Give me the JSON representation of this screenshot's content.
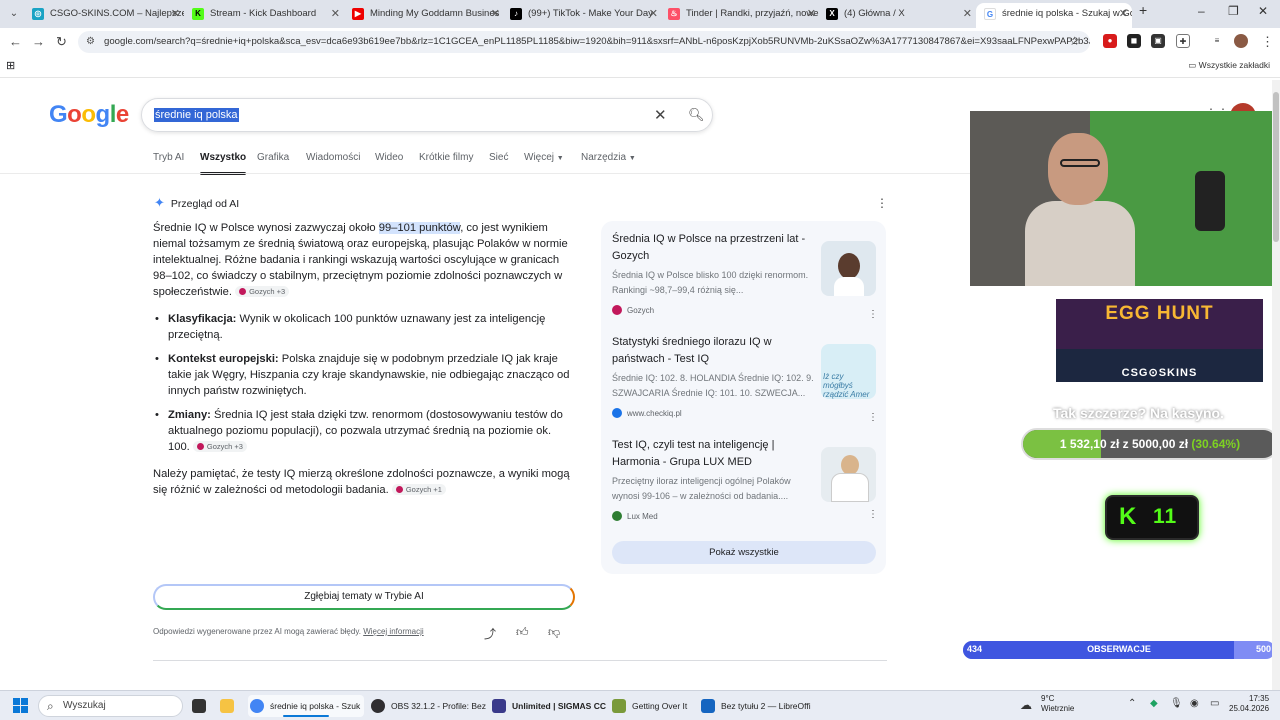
{
  "browser": {
    "tabs": [
      {
        "title": "CSGO-SKINS.COM – Najlepsze",
        "icon": "csgo-icon"
      },
      {
        "title": "Stream - Kick Dashboard",
        "icon": "kick-icon"
      },
      {
        "title": "Minding My Goddamn Busines",
        "icon": "youtube-icon"
      },
      {
        "title": "(99+) TikTok - Make Your Day",
        "icon": "tiktok-icon"
      },
      {
        "title": "Tinder | Randki, przyjaźń, nowe",
        "icon": "tinder-icon"
      },
      {
        "title": "(4) Główna / X",
        "icon": "x-icon"
      },
      {
        "title": "średnie iq polska - Szukaj w Go",
        "icon": "google-icon"
      }
    ],
    "url": "google.com/search?q=średnie+iq+polska&sca_esv=dca6e93b619ee7bb&rlz=1C1GCEA_enPL1185PL1185&biw=1920&bih=911&sxsrf=ANbL-n6posKzpjXob5RUNVMb-2uKSsaOZw%3A1777130847867&ei=X93saaLFNPexwPAP2b3Jw...",
    "bookmarks_label": "Wszystkie zakładki"
  },
  "google": {
    "logo": "Google",
    "query": "średnie iq polska",
    "tabs": [
      "Tryb AI",
      "Wszystko",
      "Grafika",
      "Wiadomości",
      "Wideo",
      "Krótkie filmy",
      "Sieć",
      "Więcej",
      "Narzędzia"
    ],
    "ai": {
      "heading": "Przegląd od AI",
      "intro_a": "Średnie IQ w Polsce wynosi zazwyczaj około ",
      "intro_hl": "99–101 punktów",
      "intro_b": ", co jest wynikiem niemal tożsamym ze średnią światową oraz europejską, plasując Polaków w normie intelektualnej. Różne badania i rankingi wskazują wartości oscylujące w granicach 98–102, co świadczy o stabilnym, przeciętnym poziomie zdolności poznawczych w społeczeństwie.",
      "intro_chip": "Gozych +3",
      "bullets": [
        {
          "label": "Klasyfikacja:",
          "text": " Wynik w okolicach 100 punktów uznawany jest za inteligencję przeciętną.",
          "chip": ""
        },
        {
          "label": "Kontekst europejski:",
          "text": " Polska znajduje się w podobnym przedziale IQ jak kraje takie jak Węgry, Hiszpania czy kraje skandynawskie, nie odbiegając znacząco od innych państw rozwiniętych.",
          "chip": ""
        },
        {
          "label": "Zmiany:",
          "text": " Średnia IQ jest stała dzięki tzw. renormom (dostosowywaniu testów do aktualnego poziomu populacji), co pozwala utrzymać średnią na poziomie ok. 100.",
          "chip": "Gozych +3"
        }
      ],
      "closing": "Należy pamiętać, że testy IQ mierzą określone zdolności poznawcze, a wyniki mogą się różnić w zależności od metodologii badania.",
      "closing_chip": "Gozych +1",
      "deep_dive": "Zgłębiaj tematy w Trybie AI",
      "disclaimer": "Odpowiedzi wygenerowane przez AI mogą zawierać błędy.",
      "more_info": "Więcej informacji"
    },
    "sources": [
      {
        "title": "Średnia IQ w Polsce na przestrzeni lat - Gozych",
        "desc": "Średnia IQ w Polsce blisko 100 dzięki renormom. Rankingi ~98,7–99,4 różnią się...",
        "site": "Gozych",
        "site_color": "#c2185b",
        "thumb_color": "#dfe8ef"
      },
      {
        "title": "Statystyki średniego ilorazu IQ w państwach - Test IQ",
        "desc": "Średnie IQ: 102. 8. HOLANDIA Średnie IQ: 102. 9. SZWAJCARIA Średnie IQ: 101. 10. SZWECJA...",
        "site": "www.checkiq.pl",
        "site_color": "#1a73e8",
        "thumb_text": "Iż czy mógłbyś rządzić Amer",
        "thumb_color": "#d8eef6"
      },
      {
        "title": "Test IQ, czyli test na inteligencję | Harmonia - Grupa LUX MED",
        "desc": "Przeciętny iloraz inteligencji ogólnej Polaków wynosi 99-106 – w zależności od badania....",
        "site": "Lux Med",
        "site_color": "#2e7d32",
        "thumb_color": "#e6ecf0"
      }
    ],
    "show_all": "Pokaż wszystkie"
  },
  "overlay": {
    "promo_title": "EGG HUNT",
    "promo_brand": "CSG⊙SKINS",
    "caption": "Tak szczerze? Na kasyno.",
    "goal_current": "1 532,10 zł",
    "goal_sep": " z ",
    "goal_target": "5000,00 zł",
    "goal_percent": "(30.64%)",
    "goal_fraction": 0.3064,
    "kick_count": "11",
    "followers_current": "434",
    "followers_label": "OBSERWACJE",
    "followers_target": "500",
    "followers_fraction": 0.868
  },
  "taskbar": {
    "search": "Wyszukaj",
    "apps": [
      {
        "label": "średnie iq polska - Szuk",
        "color": "#4285f4"
      },
      {
        "label": "OBS 32.1.2 - Profile: Bez",
        "color": "#302e31"
      },
      {
        "label": "Unlimited | SIGMAS CC",
        "color": "#3a3a8a"
      },
      {
        "label": "Getting Over It",
        "color": "#7a9a3a"
      },
      {
        "label": "Bez tytułu 2 — LibreOffi",
        "color": "#1565c0"
      }
    ],
    "weather_temp": "9°C",
    "weather_desc": "Wietrznie",
    "time": "17:35",
    "date": "25.04.2026"
  }
}
